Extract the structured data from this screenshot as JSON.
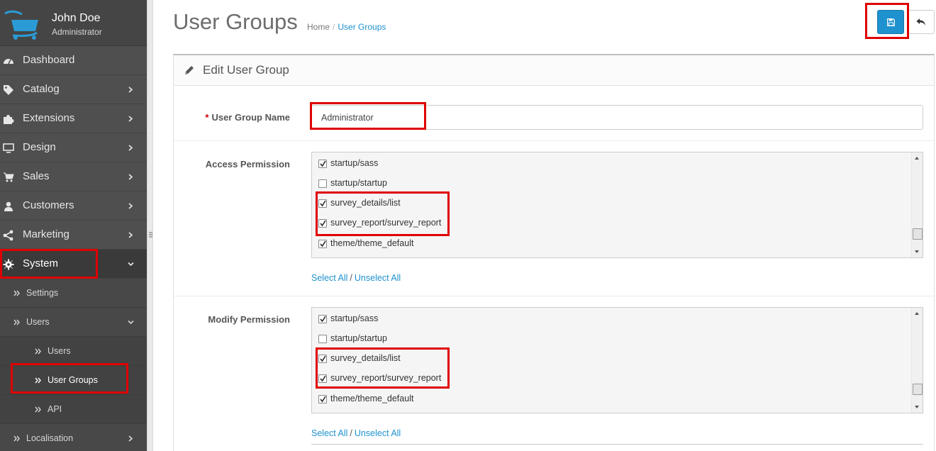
{
  "user": {
    "name": "John Doe",
    "role": "Administrator"
  },
  "nav": {
    "items": [
      {
        "label": "Dashboard"
      },
      {
        "label": "Catalog"
      },
      {
        "label": "Extensions"
      },
      {
        "label": "Design"
      },
      {
        "label": "Sales"
      },
      {
        "label": "Customers"
      },
      {
        "label": "Marketing"
      },
      {
        "label": "System"
      }
    ],
    "system_sub": [
      {
        "label": "Settings"
      },
      {
        "label": "Users"
      }
    ],
    "users_sub": [
      {
        "label": "Users"
      },
      {
        "label": "User Groups"
      },
      {
        "label": "API"
      }
    ],
    "localisation": "Localisation"
  },
  "header": {
    "title": "User Groups",
    "breadcrumb": [
      "Home",
      "User Groups"
    ]
  },
  "panel": {
    "title": "Edit User Group"
  },
  "form": {
    "group_name_label": "User Group Name",
    "group_name_value": "Administrator",
    "access_label": "Access Permission",
    "modify_label": "Modify Permission",
    "access_items": [
      {
        "label": "startup/sass",
        "checked": true
      },
      {
        "label": "startup/startup",
        "checked": false
      },
      {
        "label": "survey_details/list",
        "checked": true
      },
      {
        "label": "survey_report/survey_report",
        "checked": true
      },
      {
        "label": "theme/theme_default",
        "checked": true
      }
    ],
    "modify_items": [
      {
        "label": "startup/sass",
        "checked": true
      },
      {
        "label": "startup/startup",
        "checked": false
      },
      {
        "label": "survey_details/list",
        "checked": true
      },
      {
        "label": "survey_report/survey_report",
        "checked": true
      },
      {
        "label": "theme/theme_default",
        "checked": true
      }
    ],
    "select_all": "Select All",
    "unselect_all": "Unselect All"
  },
  "colors": {
    "primary": "#1e91cf",
    "sidebar": "#4f4f4f",
    "highlight": "#e00000"
  }
}
